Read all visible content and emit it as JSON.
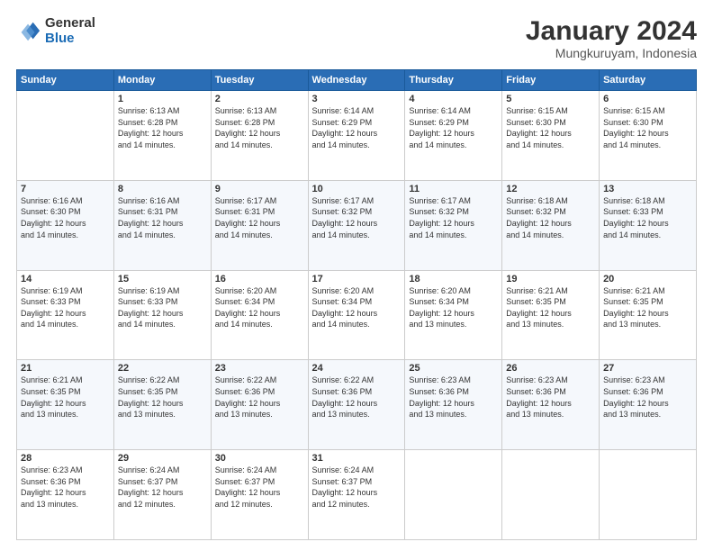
{
  "logo": {
    "general": "General",
    "blue": "Blue"
  },
  "header": {
    "month": "January 2024",
    "location": "Mungkuruyam, Indonesia"
  },
  "days_of_week": [
    "Sunday",
    "Monday",
    "Tuesday",
    "Wednesday",
    "Thursday",
    "Friday",
    "Saturday"
  ],
  "weeks": [
    [
      {
        "day": "",
        "info": ""
      },
      {
        "day": "1",
        "info": "Sunrise: 6:13 AM\nSunset: 6:28 PM\nDaylight: 12 hours\nand 14 minutes."
      },
      {
        "day": "2",
        "info": "Sunrise: 6:13 AM\nSunset: 6:28 PM\nDaylight: 12 hours\nand 14 minutes."
      },
      {
        "day": "3",
        "info": "Sunrise: 6:14 AM\nSunset: 6:29 PM\nDaylight: 12 hours\nand 14 minutes."
      },
      {
        "day": "4",
        "info": "Sunrise: 6:14 AM\nSunset: 6:29 PM\nDaylight: 12 hours\nand 14 minutes."
      },
      {
        "day": "5",
        "info": "Sunrise: 6:15 AM\nSunset: 6:30 PM\nDaylight: 12 hours\nand 14 minutes."
      },
      {
        "day": "6",
        "info": "Sunrise: 6:15 AM\nSunset: 6:30 PM\nDaylight: 12 hours\nand 14 minutes."
      }
    ],
    [
      {
        "day": "7",
        "info": "Sunrise: 6:16 AM\nSunset: 6:30 PM\nDaylight: 12 hours\nand 14 minutes."
      },
      {
        "day": "8",
        "info": "Sunrise: 6:16 AM\nSunset: 6:31 PM\nDaylight: 12 hours\nand 14 minutes."
      },
      {
        "day": "9",
        "info": "Sunrise: 6:17 AM\nSunset: 6:31 PM\nDaylight: 12 hours\nand 14 minutes."
      },
      {
        "day": "10",
        "info": "Sunrise: 6:17 AM\nSunset: 6:32 PM\nDaylight: 12 hours\nand 14 minutes."
      },
      {
        "day": "11",
        "info": "Sunrise: 6:17 AM\nSunset: 6:32 PM\nDaylight: 12 hours\nand 14 minutes."
      },
      {
        "day": "12",
        "info": "Sunrise: 6:18 AM\nSunset: 6:32 PM\nDaylight: 12 hours\nand 14 minutes."
      },
      {
        "day": "13",
        "info": "Sunrise: 6:18 AM\nSunset: 6:33 PM\nDaylight: 12 hours\nand 14 minutes."
      }
    ],
    [
      {
        "day": "14",
        "info": "Sunrise: 6:19 AM\nSunset: 6:33 PM\nDaylight: 12 hours\nand 14 minutes."
      },
      {
        "day": "15",
        "info": "Sunrise: 6:19 AM\nSunset: 6:33 PM\nDaylight: 12 hours\nand 14 minutes."
      },
      {
        "day": "16",
        "info": "Sunrise: 6:20 AM\nSunset: 6:34 PM\nDaylight: 12 hours\nand 14 minutes."
      },
      {
        "day": "17",
        "info": "Sunrise: 6:20 AM\nSunset: 6:34 PM\nDaylight: 12 hours\nand 14 minutes."
      },
      {
        "day": "18",
        "info": "Sunrise: 6:20 AM\nSunset: 6:34 PM\nDaylight: 12 hours\nand 13 minutes."
      },
      {
        "day": "19",
        "info": "Sunrise: 6:21 AM\nSunset: 6:35 PM\nDaylight: 12 hours\nand 13 minutes."
      },
      {
        "day": "20",
        "info": "Sunrise: 6:21 AM\nSunset: 6:35 PM\nDaylight: 12 hours\nand 13 minutes."
      }
    ],
    [
      {
        "day": "21",
        "info": "Sunrise: 6:21 AM\nSunset: 6:35 PM\nDaylight: 12 hours\nand 13 minutes."
      },
      {
        "day": "22",
        "info": "Sunrise: 6:22 AM\nSunset: 6:35 PM\nDaylight: 12 hours\nand 13 minutes."
      },
      {
        "day": "23",
        "info": "Sunrise: 6:22 AM\nSunset: 6:36 PM\nDaylight: 12 hours\nand 13 minutes."
      },
      {
        "day": "24",
        "info": "Sunrise: 6:22 AM\nSunset: 6:36 PM\nDaylight: 12 hours\nand 13 minutes."
      },
      {
        "day": "25",
        "info": "Sunrise: 6:23 AM\nSunset: 6:36 PM\nDaylight: 12 hours\nand 13 minutes."
      },
      {
        "day": "26",
        "info": "Sunrise: 6:23 AM\nSunset: 6:36 PM\nDaylight: 12 hours\nand 13 minutes."
      },
      {
        "day": "27",
        "info": "Sunrise: 6:23 AM\nSunset: 6:36 PM\nDaylight: 12 hours\nand 13 minutes."
      }
    ],
    [
      {
        "day": "28",
        "info": "Sunrise: 6:23 AM\nSunset: 6:36 PM\nDaylight: 12 hours\nand 13 minutes."
      },
      {
        "day": "29",
        "info": "Sunrise: 6:24 AM\nSunset: 6:37 PM\nDaylight: 12 hours\nand 12 minutes."
      },
      {
        "day": "30",
        "info": "Sunrise: 6:24 AM\nSunset: 6:37 PM\nDaylight: 12 hours\nand 12 minutes."
      },
      {
        "day": "31",
        "info": "Sunrise: 6:24 AM\nSunset: 6:37 PM\nDaylight: 12 hours\nand 12 minutes."
      },
      {
        "day": "",
        "info": ""
      },
      {
        "day": "",
        "info": ""
      },
      {
        "day": "",
        "info": ""
      }
    ]
  ]
}
